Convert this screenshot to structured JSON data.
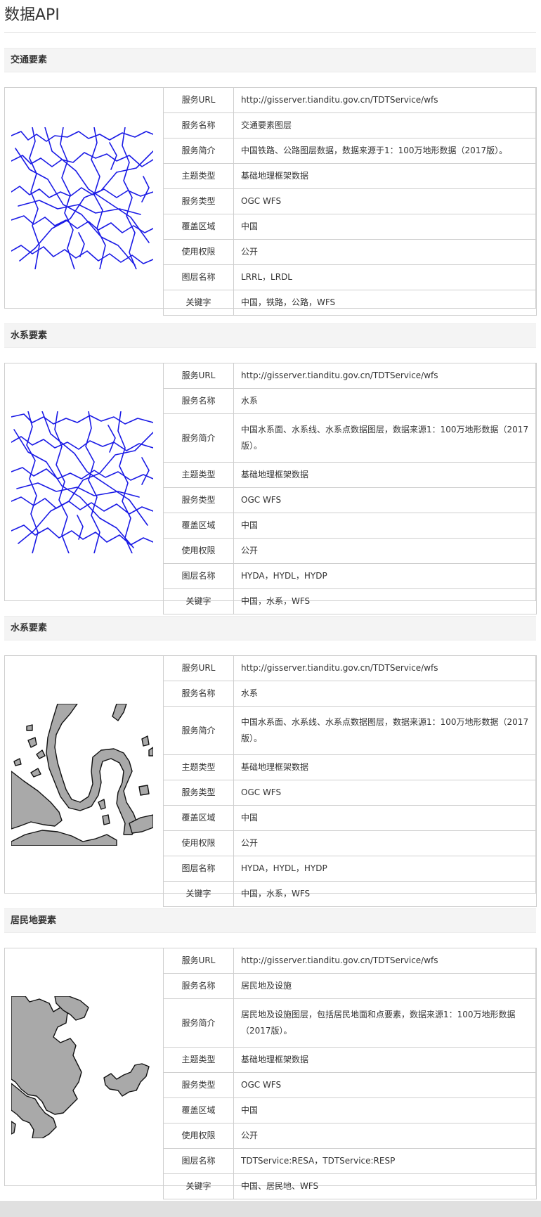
{
  "page": {
    "title": "数据API"
  },
  "sections": [
    {
      "heading": "交通要素",
      "rows": [
        {
          "key": "服务URL",
          "value": "http://gisserver.tianditu.gov.cn/TDTService/wfs"
        },
        {
          "key": "服务名称",
          "value": "交通要素图层"
        },
        {
          "key": "服务简介",
          "value": "中国铁路、公路图层数据，数据来源于1：100万地形数据（2017版）。"
        },
        {
          "key": "主题类型",
          "value": "基础地理框架数据"
        },
        {
          "key": "服务类型",
          "value": "OGC WFS"
        },
        {
          "key": "覆盖区域",
          "value": "中国"
        },
        {
          "key": "使用权限",
          "value": "公开"
        },
        {
          "key": "图层名称",
          "value": "LRRL，LRDL"
        },
        {
          "key": "关键字",
          "value": "中国，铁路，公路，WFS"
        }
      ]
    },
    {
      "heading": "水系要素",
      "rows": [
        {
          "key": "服务URL",
          "value": "http://gisserver.tianditu.gov.cn/TDTService/wfs"
        },
        {
          "key": "服务名称",
          "value": "水系"
        },
        {
          "key": "服务简介",
          "value": "中国水系面、水系线、水系点数据图层，数据来源1：100万地形数据（2017版）。"
        },
        {
          "key": "主题类型",
          "value": "基础地理框架数据"
        },
        {
          "key": "服务类型",
          "value": "OGC WFS"
        },
        {
          "key": "覆盖区域",
          "value": "中国"
        },
        {
          "key": "使用权限",
          "value": "公开"
        },
        {
          "key": "图层名称",
          "value": "HYDA，HYDL，HYDP"
        },
        {
          "key": "关键字",
          "value": "中国，水系，WFS"
        }
      ]
    },
    {
      "heading": "水系要素",
      "rows": [
        {
          "key": "服务URL",
          "value": "http://gisserver.tianditu.gov.cn/TDTService/wfs"
        },
        {
          "key": "服务名称",
          "value": "水系"
        },
        {
          "key": "服务简介",
          "value": "中国水系面、水系线、水系点数据图层，数据来源1：100万地形数据（2017版）。"
        },
        {
          "key": "主题类型",
          "value": "基础地理框架数据"
        },
        {
          "key": "服务类型",
          "value": "OGC WFS"
        },
        {
          "key": "覆盖区域",
          "value": "中国"
        },
        {
          "key": "使用权限",
          "value": "公开"
        },
        {
          "key": "图层名称",
          "value": "HYDA，HYDL，HYDP"
        },
        {
          "key": "关键字",
          "value": "中国，水系，WFS"
        }
      ]
    },
    {
      "heading": "居民地要素",
      "rows": [
        {
          "key": "服务URL",
          "value": "http://gisserver.tianditu.gov.cn/TDTService/wfs"
        },
        {
          "key": "服务名称",
          "value": "居民地及设施"
        },
        {
          "key": "服务简介",
          "value": "居民地及设施图层，包括居民地面和点要素，数据来源1：100万地形数据（2017版）。"
        },
        {
          "key": "主题类型",
          "value": "基础地理框架数据"
        },
        {
          "key": "服务类型",
          "value": "OGC WFS"
        },
        {
          "key": "覆盖区域",
          "value": "中国"
        },
        {
          "key": "使用权限",
          "value": "公开"
        },
        {
          "key": "图层名称",
          "value": "TDTService:RESA，TDTService:RESP"
        },
        {
          "key": "关键字",
          "value": "中国、居民地、WFS"
        }
      ]
    }
  ],
  "colors": {
    "line_map": "#1a1ae6",
    "polygon_fill": "#a9a9a9",
    "polygon_stroke": "#111111"
  },
  "icons": [
    "road-network-map-icon",
    "river-network-map-icon",
    "water-area-map-icon",
    "settlement-map-icon"
  ]
}
